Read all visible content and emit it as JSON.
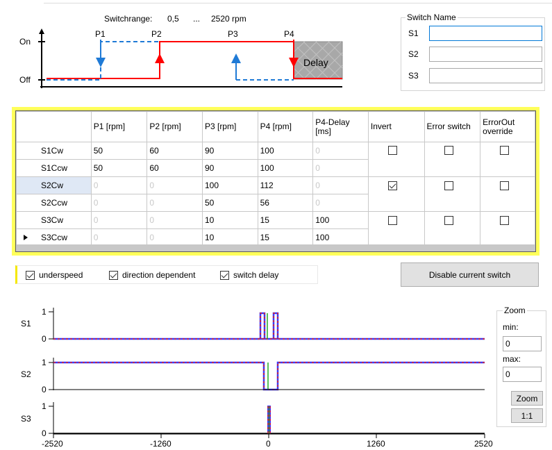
{
  "diagram": {
    "switchrange_label": "Switchrange:",
    "range_min": "0,5",
    "range_sep": "...",
    "range_max": "2520 rpm",
    "on_label": "On",
    "off_label": "Off",
    "points": [
      "P1",
      "P2",
      "P3",
      "P4"
    ],
    "delay_label": "Delay",
    "colors": {
      "red": "#ff0000",
      "blue": "#1f7ad6",
      "delay_fill": "#a8a8a8"
    }
  },
  "switch_name": {
    "legend": "Switch Name",
    "fields": [
      {
        "label": "S1",
        "value": ""
      },
      {
        "label": "S2",
        "value": ""
      },
      {
        "label": "S3",
        "value": ""
      }
    ]
  },
  "grid": {
    "headers": [
      "",
      "P1 [rpm]",
      "P2 [rpm]",
      "P3 [rpm]",
      "P4 [rpm]",
      "P4-Delay [ms]",
      "Invert",
      "Error switch",
      "ErrorOut override"
    ],
    "rows": [
      {
        "name": "S1Cw",
        "p1": "50",
        "p2": "60",
        "p3": "90",
        "p4": "100",
        "delay": "0"
      },
      {
        "name": "S1Ccw",
        "p1": "50",
        "p2": "60",
        "p3": "90",
        "p4": "100",
        "delay": "0"
      },
      {
        "name": "S2Cw",
        "p1": "0",
        "p2": "0",
        "p3": "100",
        "p4": "112",
        "delay": "0"
      },
      {
        "name": "S2Ccw",
        "p1": "0",
        "p2": "0",
        "p3": "50",
        "p4": "56",
        "delay": "0"
      },
      {
        "name": "S3Cw",
        "p1": "0",
        "p2": "0",
        "p3": "10",
        "p4": "15",
        "delay": "100"
      },
      {
        "name": "S3Ccw",
        "p1": "0",
        "p2": "0",
        "p3": "10",
        "p4": "15",
        "delay": "100"
      }
    ],
    "switch_flags": [
      {
        "invert": false,
        "error_switch": false,
        "errorout_override": false
      },
      {
        "invert": true,
        "error_switch": false,
        "errorout_override": false
      },
      {
        "invert": false,
        "error_switch": false,
        "errorout_override": false
      }
    ]
  },
  "options": {
    "underspeed": {
      "label": "underspeed",
      "checked": true
    },
    "direction_dependent": {
      "label": "direction dependent",
      "checked": true
    },
    "switch_delay": {
      "label": "switch delay",
      "checked": true
    }
  },
  "disable_button_label": "Disable current switch",
  "plots": {
    "x_ticks": [
      "-2520",
      "-1260",
      "0",
      "1260",
      "2520"
    ],
    "y_ticks": [
      "0",
      "1"
    ],
    "channels": [
      "S1",
      "S2",
      "S3"
    ]
  },
  "zoom": {
    "legend": "Zoom",
    "min_label": "min:",
    "min_value": "0",
    "max_label": "max:",
    "max_value": "0",
    "zoom_button": "Zoom",
    "reset_button": "1:1"
  }
}
